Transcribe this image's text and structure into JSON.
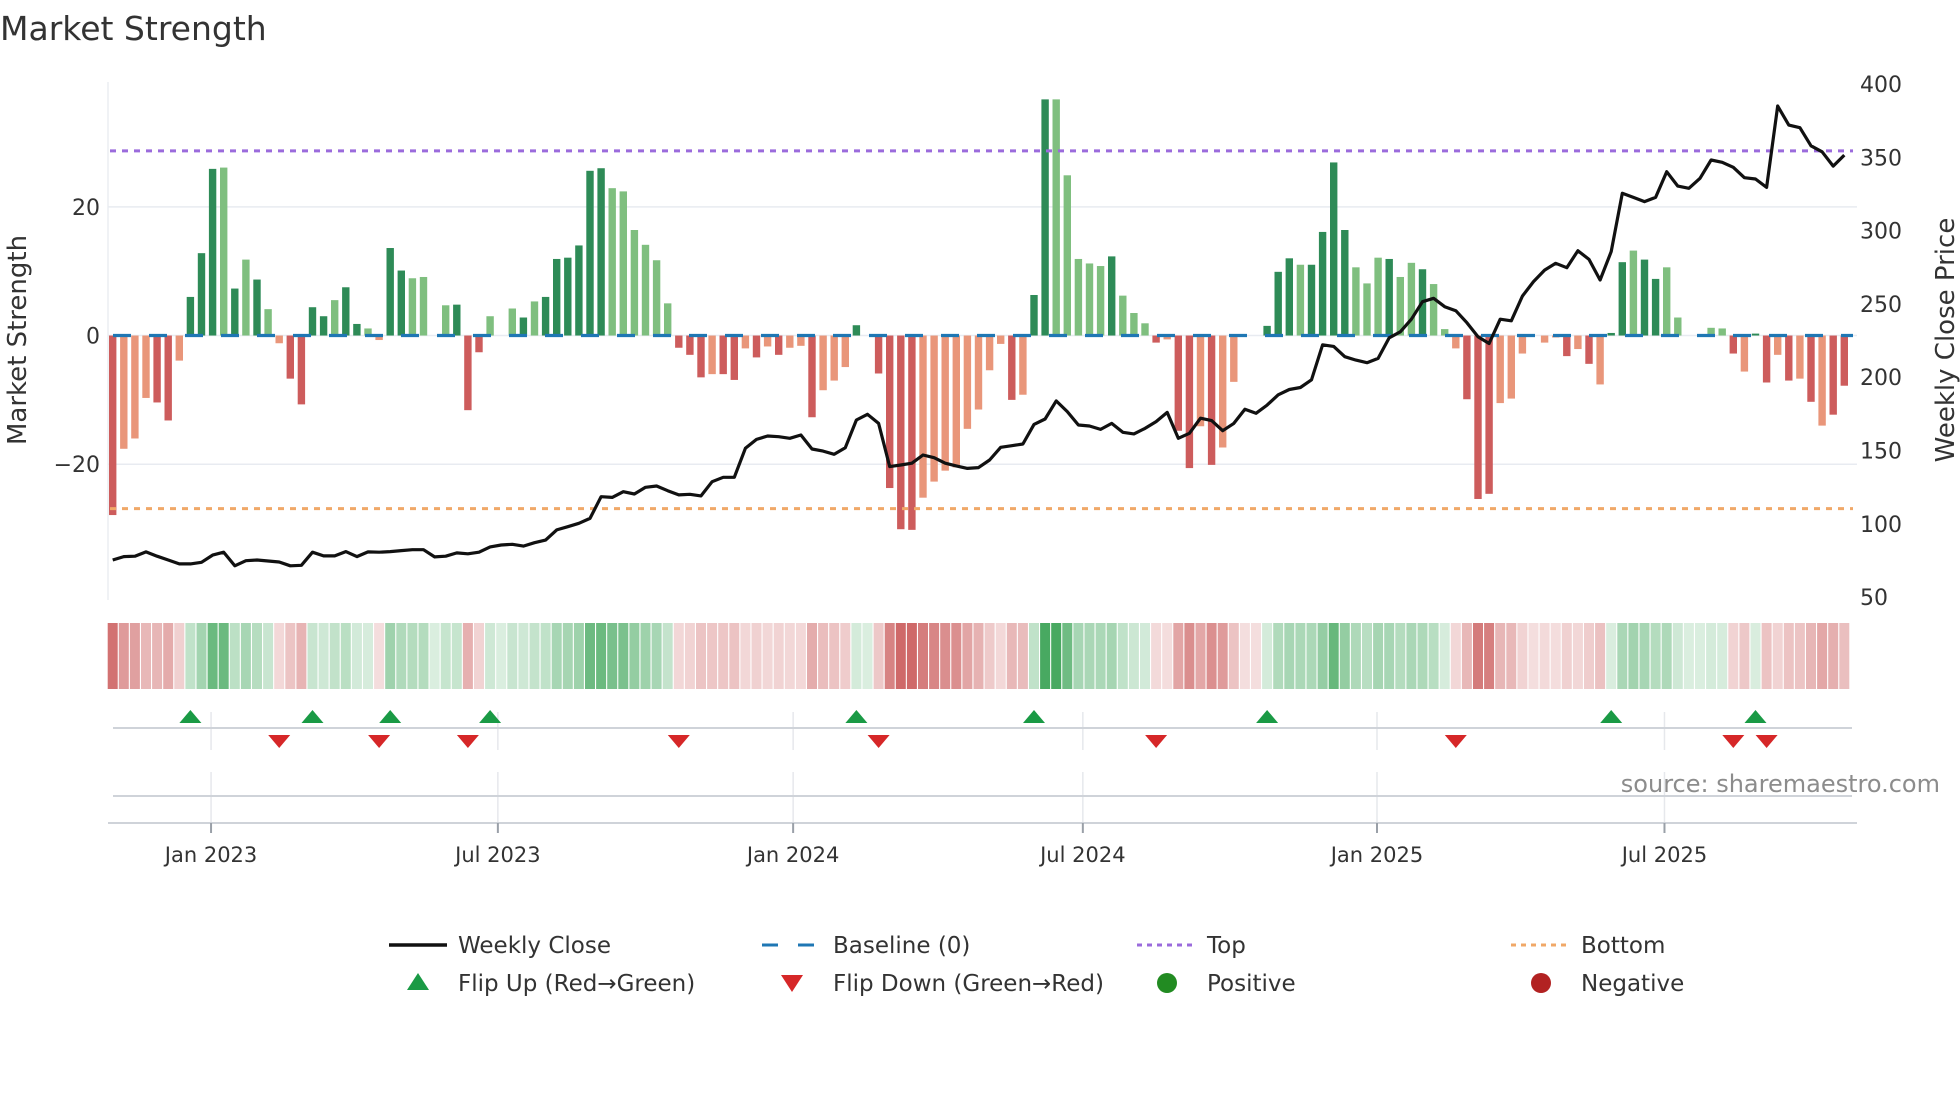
{
  "title": "Market Strength",
  "source": "source: sharemaestro.com",
  "legend": [
    {
      "label": "Weekly Close",
      "icon": "solid-line",
      "color": "#111111"
    },
    {
      "label": "Baseline (0)",
      "icon": "dashed-line",
      "color": "#1f77b4"
    },
    {
      "label": "Top",
      "icon": "dotted-line",
      "color": "#9b6bdc"
    },
    {
      "label": "Bottom",
      "icon": "dotted-line",
      "color": "#f0a868"
    },
    {
      "label": "Flip Up (Red→Green)",
      "icon": "triangle-up",
      "color": "#1a9a45"
    },
    {
      "label": "Flip Down (Green→Red)",
      "icon": "triangle-down",
      "color": "#d62728"
    },
    {
      "label": "Positive",
      "icon": "circle",
      "color": "#228b22"
    },
    {
      "label": "Negative",
      "icon": "circle",
      "color": "#b22222"
    }
  ],
  "chart_data": {
    "type": "bar+line",
    "title": "Market Strength",
    "ylabel": "Market Strength",
    "y2label": "Weekly Close Price",
    "ylim": [
      -41.1,
      39.4
    ],
    "y2lim": [
      48,
      401.4
    ],
    "grid": true,
    "legend_position": "bottom",
    "yticks": [
      {
        "value": 20,
        "label": "20"
      },
      {
        "value": 0,
        "label": "0"
      },
      {
        "value": -20,
        "label": "−20"
      }
    ],
    "y2ticks": [
      {
        "value": 400,
        "label": "400"
      },
      {
        "value": 350,
        "label": "350"
      },
      {
        "value": 300,
        "label": "300"
      },
      {
        "value": 250,
        "label": "250"
      },
      {
        "value": 200,
        "label": "200"
      },
      {
        "value": 150,
        "label": "150"
      },
      {
        "value": 100,
        "label": "100"
      },
      {
        "value": 50,
        "label": "50"
      }
    ],
    "xticks": [
      {
        "label": "Jan 2023",
        "week": 8.86
      },
      {
        "label": "Jul 2023",
        "week": 34.7
      },
      {
        "label": "Jan 2024",
        "week": 61.3
      },
      {
        "label": "Jul 2024",
        "week": 87.4
      },
      {
        "label": "Jan 2025",
        "week": 113.9
      },
      {
        "label": "Jul 2025",
        "week": 139.8
      }
    ],
    "top_level": 28.7,
    "bottom_level": -26.9,
    "baseline": 0,
    "strength": [
      -27.9,
      -17.6,
      -16.0,
      -9.7,
      -10.4,
      -13.2,
      -3.9,
      6.0,
      12.8,
      25.9,
      26.1,
      7.3,
      11.8,
      8.7,
      4.1,
      -1.2,
      -6.7,
      -10.7,
      4.4,
      3.0,
      5.5,
      7.5,
      1.8,
      1.1,
      -0.7,
      13.6,
      10.1,
      8.9,
      9.1,
      0,
      4.7,
      4.8,
      -11.6,
      -2.6,
      3.0,
      0,
      4.2,
      2.8,
      5.3,
      6.0,
      11.9,
      12.1,
      14.0,
      25.6,
      26.0,
      22.9,
      22.4,
      16.4,
      14.1,
      11.7,
      5.0,
      -1.9,
      -3.0,
      -6.5,
      -6.0,
      -6.0,
      -6.9,
      -2.0,
      -3.4,
      -1.7,
      -3.0,
      -1.9,
      -1.6,
      -12.7,
      -8.5,
      -7.0,
      -4.9,
      1.6,
      0,
      -5.9,
      -23.7,
      -30.1,
      -30.2,
      -25.2,
      -22.7,
      -21.0,
      -20.5,
      -14.5,
      -11.5,
      -5.4,
      -1.3,
      -10.0,
      -9.2,
      6.3,
      36.7,
      36.7,
      24.9,
      11.9,
      11.2,
      10.8,
      12.3,
      6.2,
      3.5,
      1.9,
      -1.1,
      -0.6,
      -14.8,
      -20.6,
      -14.1,
      -20.1,
      -17.4,
      -7.2,
      0,
      0,
      1.5,
      9.9,
      12.0,
      11.0,
      11.0,
      16.1,
      26.9,
      16.4,
      10.6,
      8.1,
      12.1,
      11.9,
      9.1,
      11.3,
      10.3,
      8.0,
      1.0,
      -2.0,
      -9.9,
      -25.4,
      -24.6,
      -10.5,
      -9.8,
      -2.8,
      0,
      -1.1,
      -0.3,
      -3.2,
      -2.1,
      -4.4,
      -7.6,
      0.4,
      11.4,
      13.2,
      11.8,
      8.8,
      10.6,
      2.8,
      0,
      0,
      1.2,
      1.1,
      -2.8,
      -5.6,
      0.3,
      -7.3,
      -3.0,
      -7.0,
      -6.7,
      -10.3,
      -14.0,
      -12.3,
      -7.8
    ],
    "tone": "dlllddldddldldllddddlddllddlldldddldldlddddddlllllldddlddldldlldllldlddddlllllllldlddllllldllldlddldlllldddlddddllldlldllldddlllllldldlddlddlldllldlddldldlddll",
    "close": [
      75.3,
      77.6,
      77.9,
      80.8,
      77.9,
      75.3,
      72.6,
      72.6,
      73.7,
      78.6,
      80.6,
      71.3,
      74.8,
      75.3,
      74.6,
      73.9,
      71.3,
      71.7,
      80.6,
      78.1,
      78.1,
      81.0,
      77.6,
      80.8,
      80.6,
      81.0,
      81.7,
      82.3,
      82.3,
      77.4,
      77.9,
      80.1,
      79.5,
      80.6,
      84.2,
      85.5,
      86.0,
      84.8,
      87.1,
      88.9,
      95.8,
      98.0,
      100.3,
      103.7,
      118.5,
      118.0,
      121.9,
      120.3,
      124.9,
      125.8,
      122.6,
      119.7,
      120.1,
      119.0,
      128.7,
      131.7,
      131.7,
      151.5,
      157.6,
      159.9,
      159.4,
      158.3,
      160.6,
      151.0,
      149.6,
      147.4,
      151.9,
      170.8,
      174.7,
      168.5,
      139.0,
      140.1,
      141.3,
      146.9,
      145.1,
      141.3,
      139.5,
      137.8,
      138.3,
      143.5,
      152.2,
      153.3,
      154.4,
      167.8,
      171.5,
      183.8,
      176.5,
      167.4,
      166.7,
      164.4,
      168.5,
      162.4,
      161.3,
      165.1,
      169.7,
      176.0,
      158.3,
      161.7,
      172.0,
      170.4,
      163.5,
      168.5,
      178.1,
      175.4,
      181.0,
      188.0,
      191.6,
      193.0,
      198.2,
      222.1,
      221.0,
      214.0,
      211.7,
      209.9,
      212.8,
      226.9,
      231.0,
      239.6,
      251.5,
      253.8,
      248.1,
      245.4,
      237.2,
      227.6,
      223.0,
      239.6,
      238.5,
      255.3,
      265.2,
      273.1,
      277.7,
      274.7,
      286.3,
      280.4,
      266.3,
      285.7,
      325.5,
      322.7,
      319.8,
      322.7,
      340.2,
      330.4,
      328.9,
      335.7,
      348.2,
      346.6,
      343.2,
      336.1,
      335.2,
      329.5,
      385.0,
      372.0,
      370.2,
      357.9,
      353.8,
      344.0,
      351.5
    ],
    "flip_up_weeks": [
      8,
      19,
      26,
      35,
      68,
      84,
      105,
      136,
      149
    ],
    "flip_down_weeks": [
      16,
      25,
      33,
      52,
      70,
      95,
      122,
      147,
      150
    ],
    "colors": {
      "pos_strong": "#2e8b57",
      "pos_fading": "#7fbf7f",
      "neg_strong": "#cd5c5c",
      "neg_fading": "#e9967a",
      "baseline": "#1f77b4",
      "top": "#9b6bdc",
      "bottom": "#f0a868",
      "close": "#111111",
      "flip_up": "#1a9a45",
      "flip_down": "#d62728"
    }
  }
}
